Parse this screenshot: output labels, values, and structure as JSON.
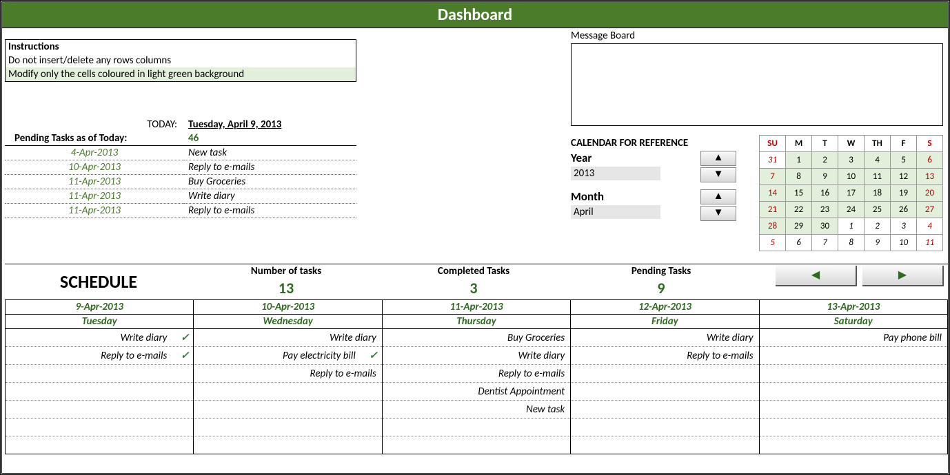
{
  "title": "Dashboard",
  "instructions": {
    "header": "Instructions",
    "line1": "Do not insert/delete any rows columns",
    "line2": "Modify only the cells coloured in light green background"
  },
  "message_board": {
    "label": "Message Board",
    "content": ""
  },
  "today": {
    "label": "TODAY:",
    "value": "Tuesday, April 9, 2013",
    "pending_label": "Pending Tasks as of Today:",
    "pending_count": "46"
  },
  "pending_list": [
    {
      "date": "4-Apr-2013",
      "task": "New task"
    },
    {
      "date": "10-Apr-2013",
      "task": "Reply to e-mails"
    },
    {
      "date": "11-Apr-2013",
      "task": "Buy Groceries"
    },
    {
      "date": "11-Apr-2013",
      "task": "Write diary"
    },
    {
      "date": "11-Apr-2013",
      "task": "Reply to e-mails"
    }
  ],
  "calendar_ref": {
    "caption": "CALENDAR FOR REFERENCE",
    "year_label": "Year",
    "year_value": "2013",
    "month_label": "Month",
    "month_value": "April"
  },
  "mini_calendar": {
    "dow": [
      "SU",
      "M",
      "T",
      "W",
      "TH",
      "F",
      "S"
    ],
    "weeks": [
      [
        {
          "d": "31",
          "in": false,
          "we": true
        },
        {
          "d": "1",
          "in": true
        },
        {
          "d": "2",
          "in": true
        },
        {
          "d": "3",
          "in": true
        },
        {
          "d": "4",
          "in": true
        },
        {
          "d": "5",
          "in": true
        },
        {
          "d": "6",
          "in": true,
          "we": true
        }
      ],
      [
        {
          "d": "7",
          "in": true,
          "we": true
        },
        {
          "d": "8",
          "in": true
        },
        {
          "d": "9",
          "in": true
        },
        {
          "d": "10",
          "in": true
        },
        {
          "d": "11",
          "in": true
        },
        {
          "d": "12",
          "in": true
        },
        {
          "d": "13",
          "in": true,
          "we": true
        }
      ],
      [
        {
          "d": "14",
          "in": true,
          "we": true
        },
        {
          "d": "15",
          "in": true
        },
        {
          "d": "16",
          "in": true
        },
        {
          "d": "17",
          "in": true
        },
        {
          "d": "18",
          "in": true
        },
        {
          "d": "19",
          "in": true
        },
        {
          "d": "20",
          "in": true,
          "we": true
        }
      ],
      [
        {
          "d": "21",
          "in": true,
          "we": true
        },
        {
          "d": "22",
          "in": true
        },
        {
          "d": "23",
          "in": true
        },
        {
          "d": "24",
          "in": true
        },
        {
          "d": "25",
          "in": true
        },
        {
          "d": "26",
          "in": true
        },
        {
          "d": "27",
          "in": true,
          "we": true
        }
      ],
      [
        {
          "d": "28",
          "in": true,
          "we": true
        },
        {
          "d": "29",
          "in": true
        },
        {
          "d": "30",
          "in": true
        },
        {
          "d": "1",
          "in": false
        },
        {
          "d": "2",
          "in": false
        },
        {
          "d": "3",
          "in": false
        },
        {
          "d": "4",
          "in": false,
          "we": true
        }
      ],
      [
        {
          "d": "5",
          "in": false,
          "we": true
        },
        {
          "d": "6",
          "in": false
        },
        {
          "d": "7",
          "in": false
        },
        {
          "d": "8",
          "in": false
        },
        {
          "d": "9",
          "in": false
        },
        {
          "d": "10",
          "in": false
        },
        {
          "d": "11",
          "in": false,
          "we": true
        }
      ]
    ]
  },
  "stats": {
    "schedule_label": "SCHEDULE",
    "num_tasks_label": "Number of tasks",
    "num_tasks": "13",
    "completed_label": "Completed Tasks",
    "completed": "3",
    "pending_label": "Pending Tasks",
    "pending": "9"
  },
  "schedule": {
    "days": [
      {
        "date": "9-Apr-2013",
        "dow": "Tuesday"
      },
      {
        "date": "10-Apr-2013",
        "dow": "Wednesday"
      },
      {
        "date": "11-Apr-2013",
        "dow": "Thursday"
      },
      {
        "date": "12-Apr-2013",
        "dow": "Friday"
      },
      {
        "date": "13-Apr-2013",
        "dow": "Saturday"
      }
    ],
    "rows": [
      [
        {
          "task": "Write diary",
          "done": true
        },
        {
          "task": "Write diary"
        },
        {
          "task": "Buy Groceries"
        },
        {
          "task": "Write diary"
        },
        {
          "task": "Pay phone bill"
        }
      ],
      [
        {
          "task": "Reply to e-mails",
          "done": true
        },
        {
          "task": "Pay electricity bill",
          "done": true
        },
        {
          "task": "Write diary"
        },
        {
          "task": "Reply to e-mails"
        },
        {
          "task": ""
        }
      ],
      [
        {
          "task": ""
        },
        {
          "task": "Reply to e-mails"
        },
        {
          "task": "Reply to e-mails"
        },
        {
          "task": ""
        },
        {
          "task": ""
        }
      ],
      [
        {
          "task": ""
        },
        {
          "task": ""
        },
        {
          "task": "Dentist Appointment"
        },
        {
          "task": ""
        },
        {
          "task": ""
        }
      ],
      [
        {
          "task": ""
        },
        {
          "task": ""
        },
        {
          "task": "New task"
        },
        {
          "task": ""
        },
        {
          "task": ""
        }
      ],
      [
        {
          "task": ""
        },
        {
          "task": ""
        },
        {
          "task": ""
        },
        {
          "task": ""
        },
        {
          "task": ""
        }
      ],
      [
        {
          "task": ""
        },
        {
          "task": ""
        },
        {
          "task": ""
        },
        {
          "task": ""
        },
        {
          "task": ""
        }
      ]
    ]
  },
  "glyphs": {
    "up": "▲",
    "down": "▼",
    "left": "◀",
    "right": "▶",
    "check": "✓"
  }
}
